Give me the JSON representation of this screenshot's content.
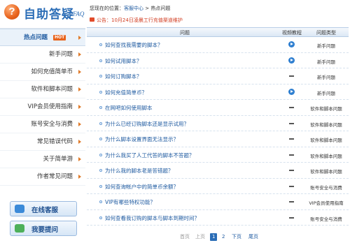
{
  "brand": {
    "icon_text": "?",
    "title": "自助答疑",
    "subtitle": "FAQ"
  },
  "nav": {
    "active": {
      "label": "热点问题",
      "badge": "HOT"
    },
    "items": [
      {
        "label": "新手问题"
      },
      {
        "label": "如何充值简单币"
      },
      {
        "label": "软件和脚本问题"
      },
      {
        "label": "VIP会员使用指南"
      },
      {
        "label": "账号安全与消费"
      },
      {
        "label": "常见错误代码"
      },
      {
        "label": "关于简单游"
      },
      {
        "label": "作者常见问题"
      }
    ]
  },
  "side_buttons": {
    "service": "在线客服",
    "ask": "我要提问"
  },
  "breadcrumb": {
    "prefix": "您现在的位置：",
    "home": "客服中心",
    "sep": " > ",
    "current": "热点问题"
  },
  "notice": {
    "text": "公告：10月24日凌晨工行充值渠道维护"
  },
  "table": {
    "headers": {
      "question": "问题",
      "video": "视频教程",
      "type": "问题类型"
    },
    "rows": [
      {
        "q": "如何查找我需要的脚本？",
        "video": true,
        "type": "新手问题"
      },
      {
        "q": "如何试用脚本？",
        "video": true,
        "type": "新手问题"
      },
      {
        "q": "如何订购脚本？",
        "video": false,
        "type": "新手问题"
      },
      {
        "q": "如何充值简单币？",
        "video": true,
        "type": "新手问题"
      },
      {
        "q": "在网吧如何使用脚本",
        "video": false,
        "type": "软件和脚本问题"
      },
      {
        "q": "为什么已经订购脚本还是显示试用？",
        "video": false,
        "type": "软件和脚本问题"
      },
      {
        "q": "为什么脚本设置界面无法显示？",
        "video": false,
        "type": "软件和脚本问题"
      },
      {
        "q": "为什么我买了人工代答的脚本不答题？",
        "video": false,
        "type": "软件和脚本问题"
      },
      {
        "q": "为什么我的脚本老是答错题？",
        "video": false,
        "type": "软件和脚本问题"
      },
      {
        "q": "如何查询帐户中的简单币余额？",
        "video": false,
        "type": "账号安全与消费"
      },
      {
        "q": "VIP有哪些特权功能？",
        "video": false,
        "type": "VIP会员使用指南"
      },
      {
        "q": "如何查看我订购的脚本与脚本到期时间？",
        "video": false,
        "type": "账号安全与消费"
      }
    ]
  },
  "pager": {
    "first": "首页",
    "prev": "上页",
    "current": "1",
    "page2": "2",
    "next": "下页",
    "last": "尾页"
  },
  "colors": {
    "brand": "#2b6db6",
    "accent": "#e8631c",
    "notice": "#d13b1f",
    "link": "#1e5aa0"
  }
}
